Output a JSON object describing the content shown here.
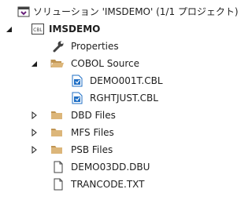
{
  "tree": {
    "solution": {
      "label": "ソリューション 'IMSDEMO' (1/1 プロジェクト)"
    },
    "project": {
      "label": "IMSDEMO",
      "badge": "CBL"
    },
    "properties": {
      "label": "Properties"
    },
    "cobol_source": {
      "label": "COBOL Source",
      "files": [
        {
          "label": "DEMO001T.CBL"
        },
        {
          "label": "RGHTJUST.CBL"
        }
      ]
    },
    "folders": [
      {
        "label": "DBD Files"
      },
      {
        "label": "MFS Files"
      },
      {
        "label": "PSB Files"
      }
    ],
    "root_files": [
      {
        "label": "DEMO03DD.DBU"
      },
      {
        "label": "TRANCODE.TXT"
      }
    ]
  },
  "colors": {
    "folder": "#dcb67a",
    "folder_dark": "#c09553",
    "file_blue": "#1f6fc5",
    "solution_purple": "#68217a",
    "arrow": "#1e1e1e"
  }
}
